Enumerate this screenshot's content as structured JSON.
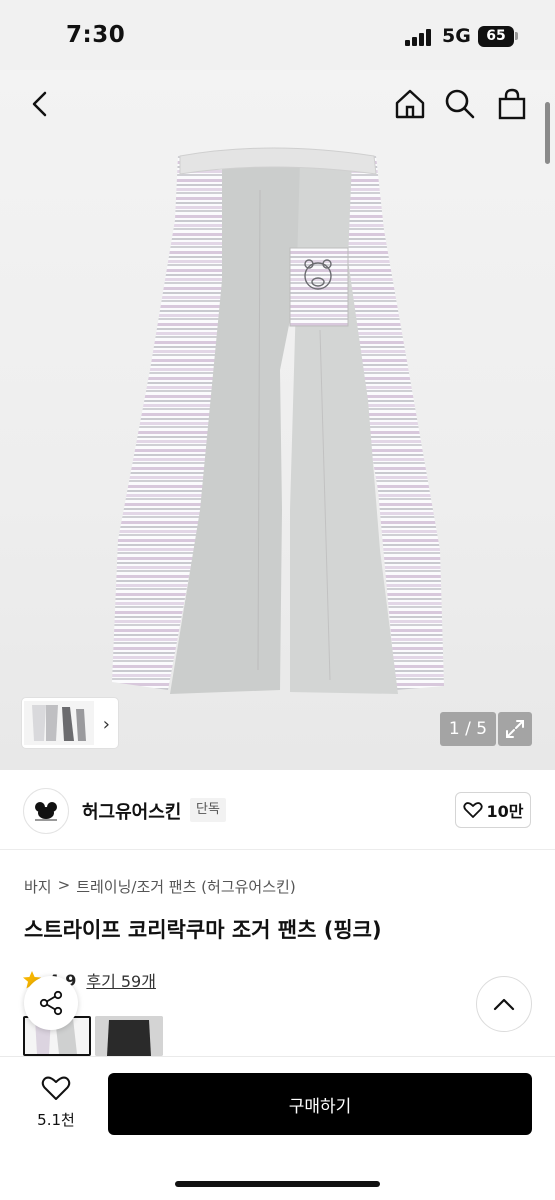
{
  "status_bar": {
    "time": "7:30",
    "network": "5G",
    "battery": "65"
  },
  "nav": {
    "back_icon": "chevron-left-icon",
    "home_icon": "home-icon",
    "search_icon": "search-icon",
    "bag_icon": "shopping-bag-icon"
  },
  "gallery": {
    "counter": "1 / 5",
    "expand_icon": "expand-icon"
  },
  "brand": {
    "name": "허그유어스킨",
    "badge": "단독",
    "likes": "10만"
  },
  "breadcrumb": {
    "category": "바지",
    "separator": ">",
    "subcategory": "트레이닝/조거 팬츠 (허그유어스킨)"
  },
  "product": {
    "title": "스트라이프 코리락쿠마 조거 팬츠 (핑크)"
  },
  "rating": {
    "score": "4.9",
    "reviews": "후기 59개"
  },
  "bottom_bar": {
    "wish_count": "5.1천",
    "buy_label": "구매하기"
  },
  "colors": {
    "accent": "#000000",
    "star": "#f5b400",
    "stripe_pink": "#d9c4dc"
  }
}
